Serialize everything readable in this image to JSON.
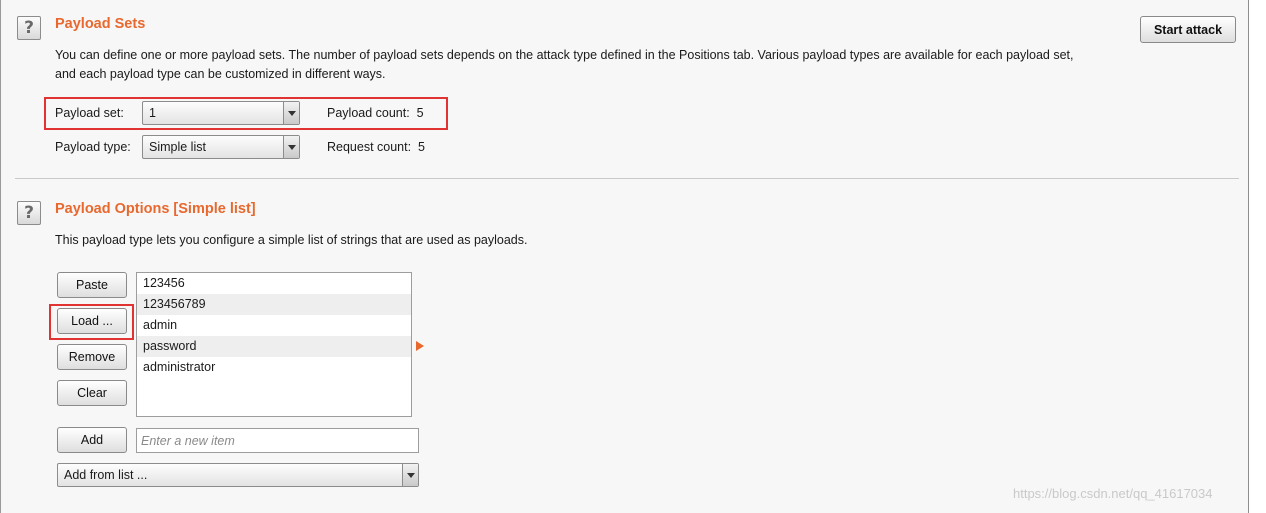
{
  "start_attack_label": "Start attack",
  "payload_sets": {
    "title": "Payload Sets",
    "desc_line1": "You can define one or more payload sets. The number of payload sets depends on the attack type defined in the Positions tab. Various payload types are available for each payload set,",
    "desc_line2": "and each payload type can be customized in different ways.",
    "set_label": "Payload set:",
    "set_value": "1",
    "count_label": "Payload count:",
    "count_value": "5",
    "type_label": "Payload type:",
    "type_value": "Simple list",
    "request_label": "Request count:",
    "request_value": "5"
  },
  "payload_options": {
    "title": "Payload Options [Simple list]",
    "desc": "This payload type lets you configure a simple list of strings that are used as payloads.",
    "paste_label": "Paste",
    "load_label": "Load ...",
    "remove_label": "Remove",
    "clear_label": "Clear",
    "add_label": "Add",
    "items": [
      "123456",
      "123456789",
      "admin",
      "password",
      "administrator"
    ],
    "new_item_placeholder": "Enter a new item",
    "add_from_list_label": "Add from list ..."
  },
  "help_glyph": "?",
  "watermark": "https://blog.csdn.net/qq_41617034",
  "colors": {
    "accent": "#e8682e",
    "highlight": "#e23333"
  }
}
